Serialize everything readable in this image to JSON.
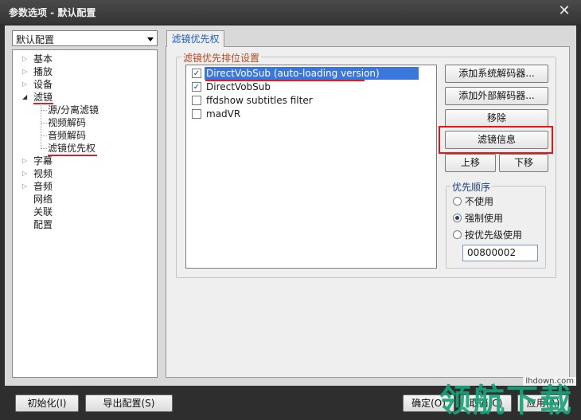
{
  "window": {
    "title": "参数选项 - 默认配置",
    "close_glyph": "✕"
  },
  "profile_combo": {
    "value": "默认配置"
  },
  "tree": [
    {
      "label": "基本",
      "expander": "▷"
    },
    {
      "label": "播放",
      "expander": "▷"
    },
    {
      "label": "设备",
      "expander": "▷"
    },
    {
      "label": "滤镜",
      "expander": "◢"
    },
    {
      "label": "源/分离滤镜",
      "expander": ""
    },
    {
      "label": "视频解码",
      "expander": ""
    },
    {
      "label": "音频解码",
      "expander": ""
    },
    {
      "label": "滤镜优先权",
      "expander": ""
    },
    {
      "label": "字幕",
      "expander": "▷"
    },
    {
      "label": "视频",
      "expander": "▷"
    },
    {
      "label": "音频",
      "expander": "▷"
    },
    {
      "label": "网络",
      "expander": ""
    },
    {
      "label": "关联",
      "expander": ""
    },
    {
      "label": "配置",
      "expander": ""
    }
  ],
  "tab": {
    "label": "滤镜优先权"
  },
  "group": {
    "title": "滤镜优先排位设置"
  },
  "filters": [
    {
      "name": "DirectVobSub (auto-loading version)",
      "check": "✓"
    },
    {
      "name": "DirectVobSub",
      "check": "✓"
    },
    {
      "name": "ffdshow subtitles filter",
      "check": ""
    },
    {
      "name": "madVR",
      "check": ""
    }
  ],
  "buttons": {
    "add_system": "添加系统解码器...",
    "add_external": "添加外部解码器...",
    "remove": "移除",
    "filter_info": "滤镜信息",
    "move_up": "上移",
    "move_down": "下移"
  },
  "priority": {
    "title": "优先顺序",
    "options": [
      "不使用",
      "强制使用",
      "按优先级使用"
    ],
    "selected_index": 1,
    "value": "00800002"
  },
  "footer": {
    "init": "初始化(I)",
    "export": "导出配置(S)",
    "ok": "确定(O)",
    "cancel": "取消(C)",
    "apply": "应用(A)"
  },
  "watermark": {
    "site": "lhdown.com",
    "brand": "领航下载"
  },
  "colors": {
    "highlight": "#3b77d8",
    "annotation_red": "#e01818"
  }
}
